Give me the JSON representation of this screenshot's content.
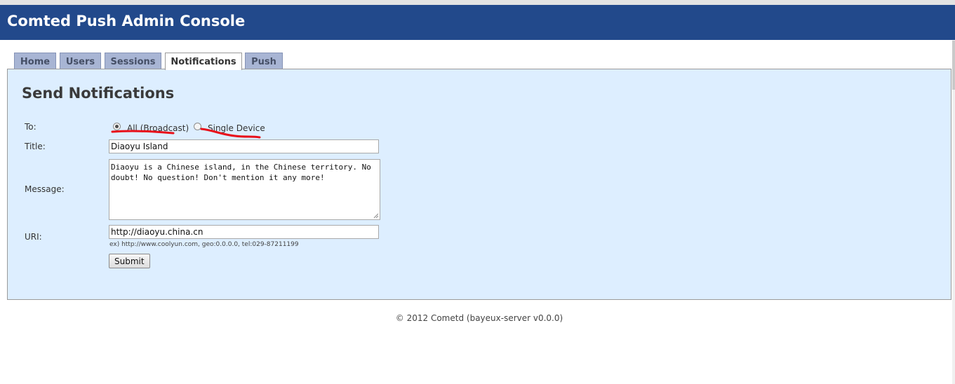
{
  "header": {
    "title": "Comted Push Admin Console"
  },
  "tabs": [
    {
      "label": "Home",
      "active": false
    },
    {
      "label": "Users",
      "active": false
    },
    {
      "label": "Sessions",
      "active": false
    },
    {
      "label": "Notifications",
      "active": true
    },
    {
      "label": "Push",
      "active": false
    }
  ],
  "panel": {
    "title": "Send Notifications"
  },
  "form": {
    "to_label": "To:",
    "to_options": [
      {
        "label": "All (Broadcast)",
        "checked": true
      },
      {
        "label": "Single Device",
        "checked": false
      }
    ],
    "title_label": "Title:",
    "title_value": "Diaoyu Island",
    "message_label": "Message:",
    "message_value": "Diaoyu is a Chinese island, in the Chinese territory. No doubt! No question! Don't mention it any more!",
    "uri_label": "URI:",
    "uri_value": "http://diaoyu.china.cn",
    "uri_hint": "ex) http://www.coolyun.com, geo:0.0.0.0, tel:029-87211199",
    "submit_label": "Submit"
  },
  "annotation_color": "#e8101a",
  "footer": {
    "text": "© 2012 Cometd (bayeux-server v0.0.0)"
  }
}
